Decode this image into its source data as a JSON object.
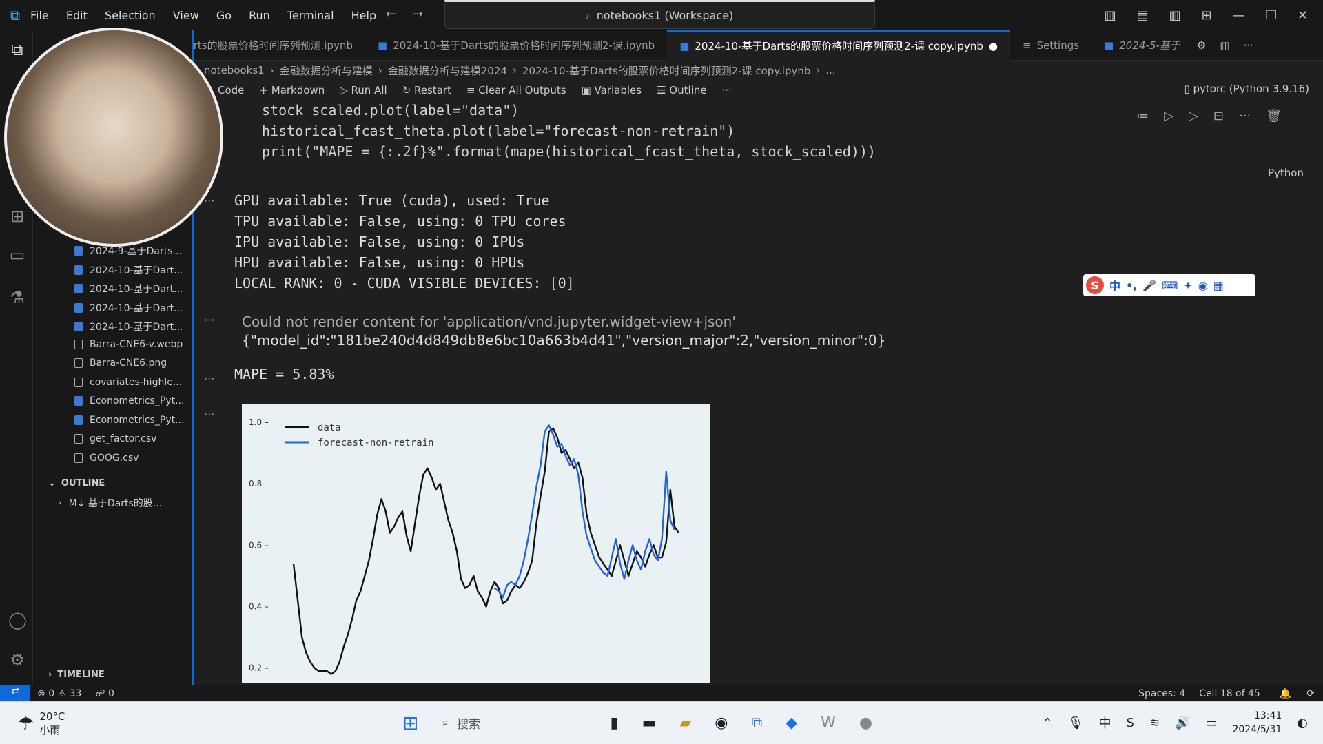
{
  "titlebar": {
    "menu": [
      "File",
      "Edit",
      "Selection",
      "View",
      "Go",
      "Run",
      "Terminal",
      "Help"
    ],
    "search": "notebooks1 (Workspace)"
  },
  "tabs": [
    {
      "label": "基于Darts的股票价格时间序列预测.ipynb",
      "active": false
    },
    {
      "label": "2024-10-基于Darts的股票价格时间序列预测2-课.ipynb",
      "active": false
    },
    {
      "label": "2024-10-基于Darts的股票价格时间序列预测2-课 copy.ipynb",
      "active": true
    },
    {
      "label": "Settings",
      "active": false
    },
    {
      "label": "2024-5-基于",
      "active": false
    }
  ],
  "breadcrumb": [
    "notebooks1",
    "金融数据分析与建模",
    "金融数据分析与建模2024",
    "2024-10-基于Darts的股票价格时间序列预测2-课 copy.ipynb",
    "..."
  ],
  "toolbar": {
    "code": "Code",
    "markdown": "Markdown",
    "run_all": "Run All",
    "restart": "Restart",
    "clear": "Clear All Outputs",
    "variables": "Variables",
    "outline": "Outline",
    "more": "···",
    "kernel": "pytorc (Python 3.9.16)"
  },
  "sidebar": {
    "files": [
      {
        "name": "2024-9-基于Darts...",
        "type": "ipynb"
      },
      {
        "name": "2024-10-基于Dart...",
        "type": "ipynb"
      },
      {
        "name": "2024-10-基于Dart...",
        "type": "ipynb"
      },
      {
        "name": "2024-10-基于Dart...",
        "type": "ipynb"
      },
      {
        "name": "2024-10-基于Dart...",
        "type": "ipynb"
      },
      {
        "name": "Barra-CNE6-v.webp",
        "type": "img"
      },
      {
        "name": "Barra-CNE6.png",
        "type": "img"
      },
      {
        "name": "covariates-highle...",
        "type": "img"
      },
      {
        "name": "Econometrics_Pyt...",
        "type": "ipynb"
      },
      {
        "name": "Econometrics_Pyt...",
        "type": "ipynb"
      },
      {
        "name": "get_factor.csv",
        "type": "csv"
      },
      {
        "name": "GOOG.csv",
        "type": "csv"
      }
    ],
    "outline_title": "OUTLINE",
    "outline_item": "M↓ 基于Darts的股...",
    "timeline_title": "TIMELINE"
  },
  "code_lines": [
    "stock_scaled.plot(label=\"data\")",
    "historical_fcast_theta.plot(label=\"forecast-non-retrain\")",
    "print(\"MAPE = {:.2f}%\".format(mape(historical_fcast_theta, stock_scaled)))"
  ],
  "cell_language": "Python",
  "output_lines": [
    "GPU available: True (cuda), used: True",
    "TPU available: False, using: 0 TPU cores",
    "IPU available: False, using: 0 IPUs",
    "HPU available: False, using: 0 HPUs",
    "LOCAL_RANK: 0 - CUDA_VISIBLE_DEVICES: [0]"
  ],
  "widget_message": "Could not render content for 'application/vnd.jupyter.widget-view+json'",
  "widget_json": "{\"model_id\":\"181be240d4d849db8e6bc10a663b4d41\",\"version_major\":2,\"version_minor\":0}",
  "mape_text": "MAPE = 5.83%",
  "ime_label": "中",
  "chart_data": {
    "type": "line",
    "ylim": [
      0.15,
      1.02
    ],
    "yticks": [
      "0.2",
      "0.4",
      "0.6",
      "0.8",
      "1.0"
    ],
    "legend_position": "top-left",
    "series": [
      {
        "name": "data",
        "color": "#111111",
        "values": [
          0.54,
          0.42,
          0.3,
          0.25,
          0.22,
          0.2,
          0.19,
          0.19,
          0.19,
          0.18,
          0.19,
          0.22,
          0.27,
          0.31,
          0.36,
          0.42,
          0.45,
          0.5,
          0.55,
          0.62,
          0.7,
          0.75,
          0.71,
          0.64,
          0.66,
          0.69,
          0.71,
          0.63,
          0.58,
          0.67,
          0.76,
          0.83,
          0.85,
          0.82,
          0.78,
          0.8,
          0.74,
          0.68,
          0.64,
          0.58,
          0.49,
          0.46,
          0.47,
          0.5,
          0.45,
          0.43,
          0.4,
          0.45,
          0.48,
          0.46,
          0.41,
          0.42,
          0.45,
          0.47,
          0.46,
          0.48,
          0.51,
          0.55,
          0.67,
          0.76,
          0.84,
          0.97,
          0.98,
          0.95,
          0.9,
          0.91,
          0.88,
          0.85,
          0.87,
          0.82,
          0.7,
          0.64,
          0.6,
          0.56,
          0.54,
          0.52,
          0.5,
          0.55,
          0.6,
          0.55,
          0.5,
          0.54,
          0.58,
          0.56,
          0.53,
          0.57,
          0.6,
          0.56,
          0.56,
          0.61,
          0.78,
          0.66,
          0.64
        ]
      },
      {
        "name": "forecast-non-retrain",
        "color": "#2465d6",
        "start_index": 48,
        "values": [
          0.46,
          0.45,
          0.43,
          0.47,
          0.48,
          0.47,
          0.5,
          0.55,
          0.62,
          0.7,
          0.79,
          0.86,
          0.97,
          0.99,
          0.96,
          0.92,
          0.93,
          0.89,
          0.86,
          0.88,
          0.83,
          0.71,
          0.63,
          0.59,
          0.55,
          0.53,
          0.51,
          0.5,
          0.56,
          0.62,
          0.54,
          0.49,
          0.55,
          0.6,
          0.55,
          0.52,
          0.58,
          0.62,
          0.57,
          0.55,
          0.62,
          0.84,
          0.68,
          0.65
        ]
      }
    ]
  },
  "status": {
    "errors": "0",
    "warnings": "33",
    "ports": "0",
    "spaces": "Spaces: 4",
    "cell": "Cell 18 of 45"
  },
  "taskbar": {
    "temp": "20°C",
    "weather": "小雨",
    "search": "搜索",
    "time": "13:41",
    "date": "2024/5/31"
  }
}
